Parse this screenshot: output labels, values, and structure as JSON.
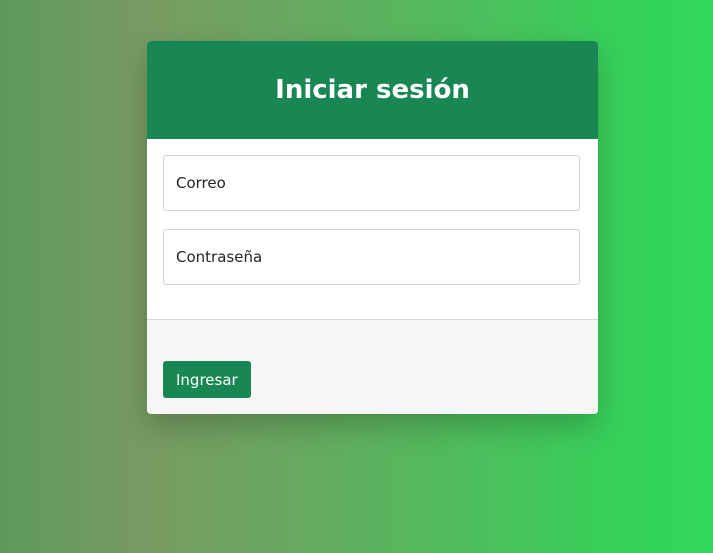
{
  "login": {
    "title": "Iniciar sesión",
    "email_placeholder": "Correo",
    "email_value": "",
    "password_placeholder": "Contraseña",
    "password_value": "",
    "submit_label": "Ingresar"
  },
  "colors": {
    "primary": "#198754",
    "footer_bg": "#f6f6f6",
    "gradient_start": "#5e9a5c",
    "gradient_end": "#30d85b"
  }
}
